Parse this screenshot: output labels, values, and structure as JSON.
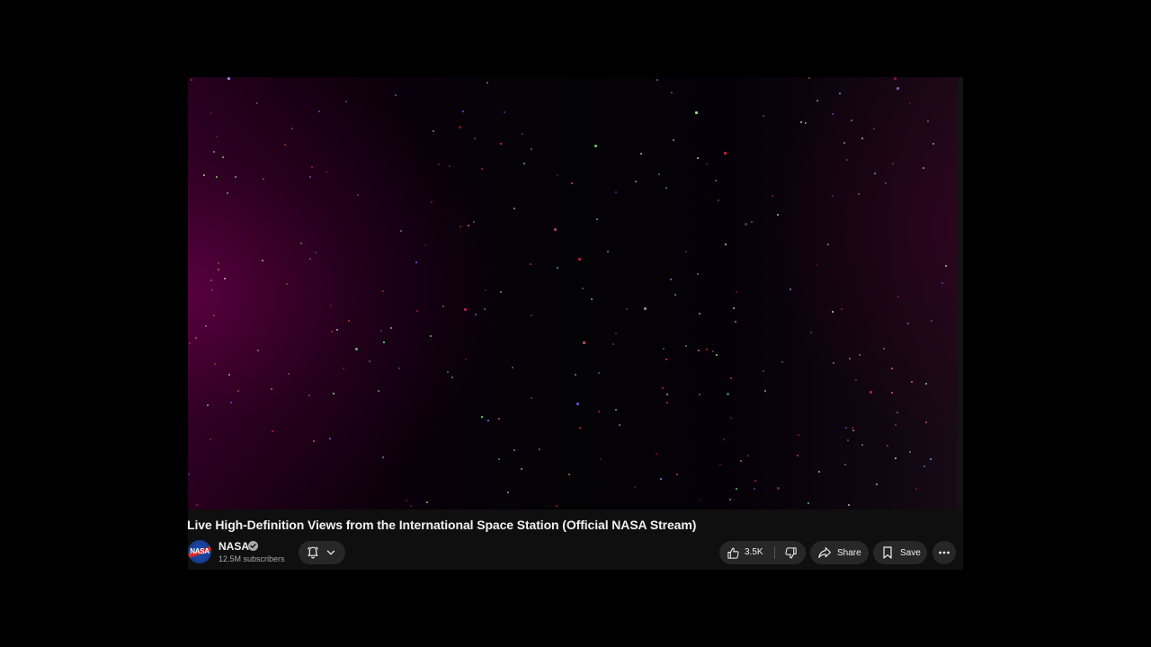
{
  "video": {
    "title": "Live High-Definition Views from the International Space Station (Official NASA Stream)"
  },
  "channel": {
    "name": "NASA",
    "subscribers": "12.5M subscribers",
    "avatar_text": "NASA",
    "verified_icon": "verified-check-icon"
  },
  "actions": {
    "notification_icon": "bell-icon",
    "dropdown_icon": "chevron-down-icon",
    "like_count": "3.5K",
    "like_icon": "thumbs-up-icon",
    "dislike_icon": "thumbs-down-icon",
    "share_label": "Share",
    "share_icon": "share-arrow-icon",
    "save_label": "Save",
    "save_icon": "bookmark-icon",
    "more_icon": "more-horizontal-icon"
  },
  "colors": {
    "page_background": "#000000",
    "panel_background": "#0f0f0f",
    "pill_background": "#272727",
    "text_primary": "#f1f1f1",
    "text_secondary": "#aaaaaa"
  }
}
